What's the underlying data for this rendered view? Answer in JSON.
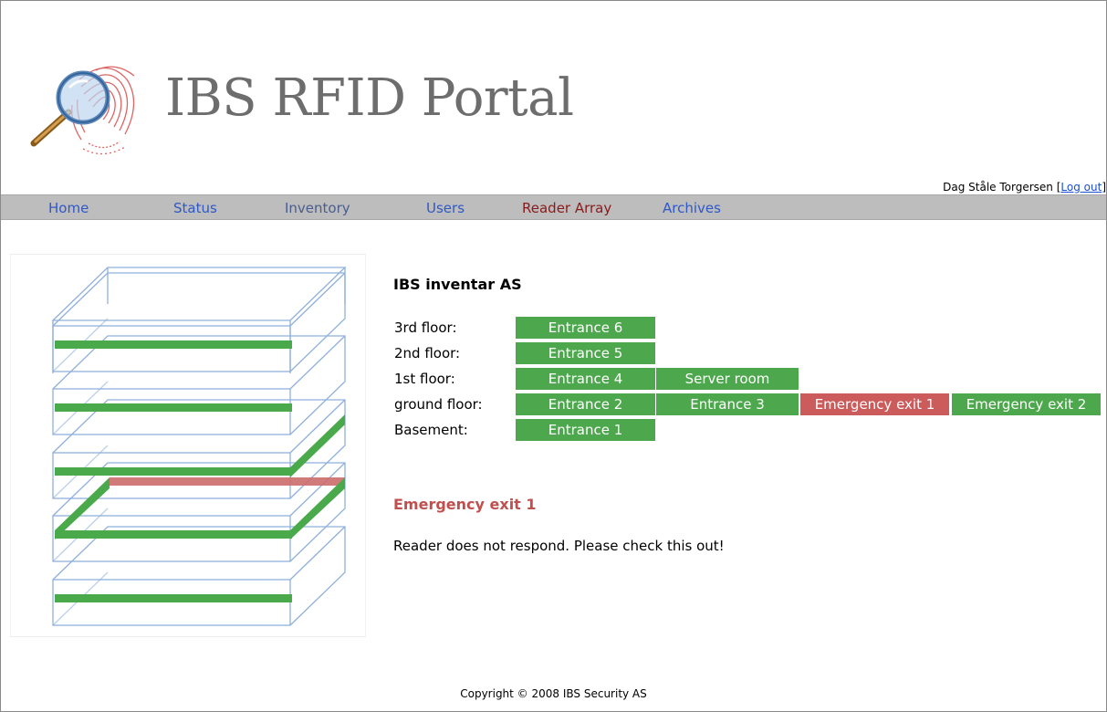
{
  "header": {
    "title": "IBS RFID Portal",
    "user_name": "Dag Ståle Torgersen",
    "bracket_open": "[",
    "logout_label": "Log out",
    "bracket_close": "]"
  },
  "nav": [
    {
      "label": "Home",
      "color": "#2f58c9"
    },
    {
      "label": "Status",
      "color": "#2f58c9"
    },
    {
      "label": "Inventory",
      "color": "#4a5d8c"
    },
    {
      "label": "Users",
      "color": "#2f58c9"
    },
    {
      "label": "Reader Array",
      "color": "#8b1a1a"
    },
    {
      "label": "Archives",
      "color": "#2f58c9"
    }
  ],
  "main": {
    "company": "IBS inventar AS",
    "floors": [
      {
        "label": "3rd floor:",
        "readers": [
          {
            "name": "Entrance 6",
            "status": "ok"
          }
        ]
      },
      {
        "label": "2nd floor:",
        "readers": [
          {
            "name": "Entrance 5",
            "status": "ok"
          }
        ]
      },
      {
        "label": "1st floor:",
        "readers": [
          {
            "name": "Entrance 4",
            "status": "ok"
          },
          {
            "name": "Server room",
            "status": "ok"
          }
        ]
      },
      {
        "label": "ground floor:",
        "readers": [
          {
            "name": "Entrance 2",
            "status": "ok"
          },
          {
            "name": "Entrance 3",
            "status": "ok"
          },
          {
            "name": "Emergency exit 1",
            "status": "error"
          },
          {
            "name": "Emergency exit 2",
            "status": "ok"
          }
        ]
      },
      {
        "label": "Basement:",
        "readers": [
          {
            "name": "Entrance 1",
            "status": "ok"
          }
        ]
      }
    ],
    "alert": {
      "title": "Emergency exit 1",
      "message": "Reader does not respond. Please check this out!"
    }
  },
  "footer": {
    "copyright": "Copyright © 2008 IBS Security AS"
  },
  "colors": {
    "ok": "#4da84d",
    "error": "#cc5b5b",
    "wireframe": "#8fb0dc",
    "nav_bg": "#bdbdbd"
  }
}
